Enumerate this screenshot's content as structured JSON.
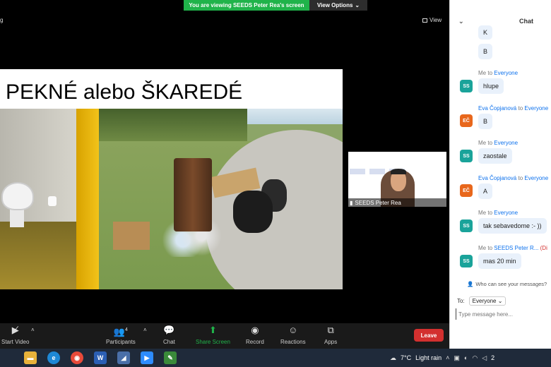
{
  "banner": {
    "viewing_text": "You are viewing SEEDS Peter Rea's screen",
    "options_label": "View Options",
    "options_icon": "chevron-down-icon"
  },
  "stage": {
    "top_left_label": "g",
    "view_label": "View"
  },
  "slide": {
    "title": "PEKNÉ alebo ŠKAREDÉ"
  },
  "speaker": {
    "name": "SEEDS Peter Rea"
  },
  "toolbar": {
    "video_label": "Start Video",
    "participants_label": "Participants",
    "participants_count": "4",
    "chat_label": "Chat",
    "share_label": "Share Screen",
    "record_label": "Record",
    "reactions_label": "Reactions",
    "apps_label": "Apps",
    "leave_label": "Leave"
  },
  "chat": {
    "title": "Chat",
    "messages": [
      {
        "text": "K",
        "avatar": ""
      },
      {
        "text": "B",
        "avatar": ""
      },
      {
        "sender": "Me",
        "to": "to",
        "target": "Everyone",
        "text": "hlupe",
        "avatar": "SS"
      },
      {
        "sender": "Eva Čopjanová",
        "to": "to",
        "target": "Everyone",
        "text": "B",
        "avatar": "EČ"
      },
      {
        "sender": "Me",
        "to": "to",
        "target": "Everyone",
        "text": "zaostale",
        "avatar": "SS"
      },
      {
        "sender": "Eva Čopjanová",
        "to": "to",
        "target": "Everyone",
        "text": "A",
        "avatar": "EČ"
      },
      {
        "sender": "Me",
        "to": "to",
        "target": "Everyone",
        "text": "tak sebavedome :- ))",
        "avatar": "SS"
      },
      {
        "sender": "Me",
        "to": "to",
        "target": "SEEDS Peter R...",
        "private": "(Di",
        "text": "mas 20 min",
        "avatar": "SS"
      }
    ],
    "who_can_see": "Who can see your messages?",
    "to_label": "To:",
    "to_value": "Everyone",
    "input_placeholder": "Type message here..."
  },
  "taskbar": {
    "weather_temp": "7°C",
    "weather_desc": "Light rain",
    "clock_partial": "2"
  },
  "colors": {
    "accent_green": "#20b34a",
    "leave_red": "#d3302f",
    "link_blue": "#0e72ed"
  }
}
